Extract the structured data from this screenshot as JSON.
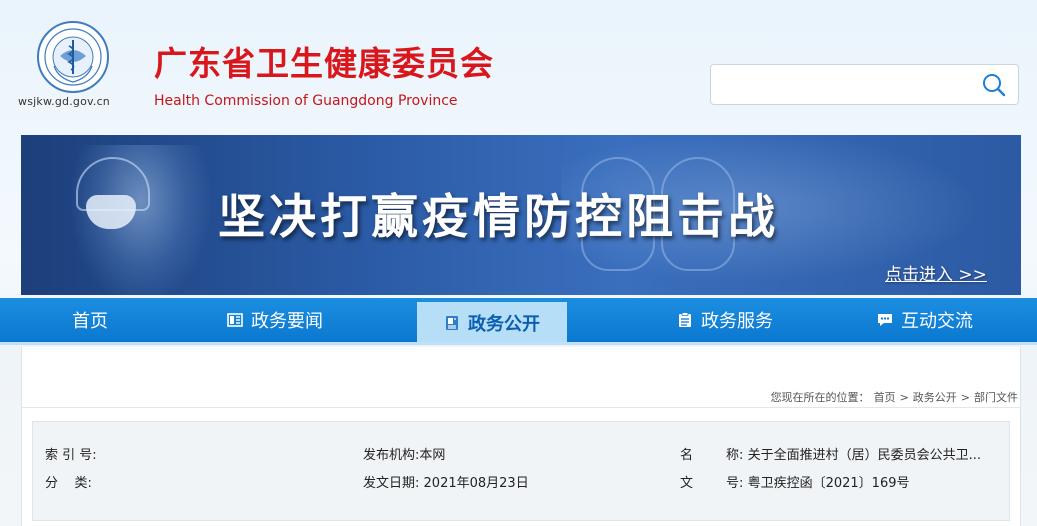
{
  "header": {
    "domain": "wsjkw.gd.gov.cn",
    "title_cn": "广东省卫生健康委员会",
    "title_en": "Health Commission of Guangdong Province",
    "search": {
      "placeholder": "",
      "icon": "search-icon"
    }
  },
  "banner": {
    "slogan": "坚决打赢疫情防控阻击战",
    "enter_label": "点击进入 >>"
  },
  "nav": {
    "items": [
      {
        "label": "首页",
        "icon": ""
      },
      {
        "label": "政务要闻",
        "icon": "news-icon"
      },
      {
        "label": "政务公开",
        "icon": "document-icon",
        "active": true
      },
      {
        "label": "政务服务",
        "icon": "clipboard-icon"
      },
      {
        "label": "互动交流",
        "icon": "chat-icon"
      }
    ]
  },
  "breadcrumb": {
    "prefix": "您现在所在的位置：",
    "items": [
      "首页",
      "政务公开",
      "部门文件"
    ],
    "separator": ">"
  },
  "meta": {
    "index_label": "索 引 号:",
    "index_value": "",
    "category_label": "分    类:",
    "category_value": "",
    "publisher_label": "发布机构:",
    "publisher_value": "本网",
    "date_label": "发文日期:",
    "date_value": "2021年08月23日",
    "name_label": "名        称:",
    "name_value": "关于全面推进村（居）民委员会公共卫...",
    "doc_no_label": "文        号:",
    "doc_no_value": "粤卫疾控函〔2021〕169号"
  },
  "colors": {
    "brand_red": "#d8161b",
    "nav_blue": "#0a78cf",
    "nav_active_bg": "#b7def7"
  }
}
